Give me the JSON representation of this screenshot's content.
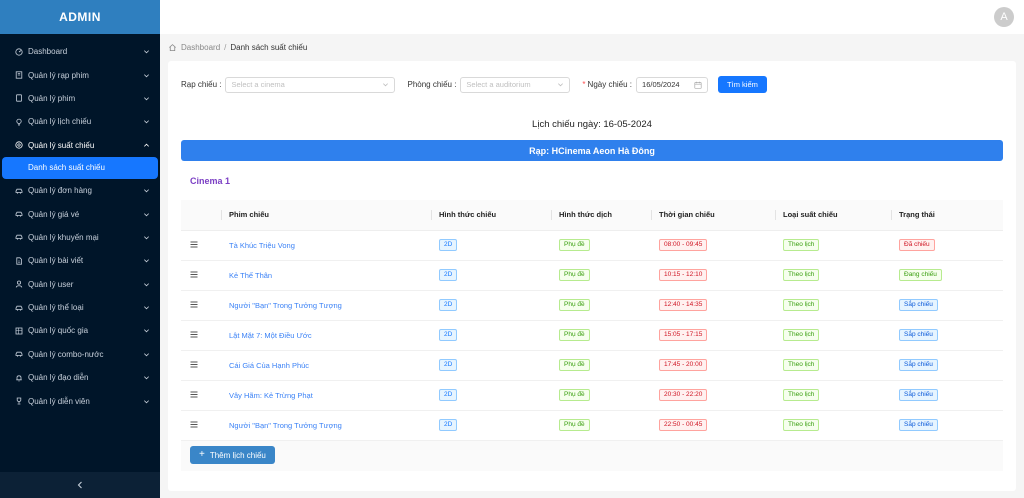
{
  "brand": "ADMIN",
  "sidebar": {
    "items": [
      {
        "label": "Dashboard",
        "icon": "dashboard-icon"
      },
      {
        "label": "Quản lý rạp phim",
        "icon": "building-icon"
      },
      {
        "label": "Quản lý phim",
        "icon": "film-icon"
      },
      {
        "label": "Quản lý lịch chiếu",
        "icon": "bulb-icon"
      },
      {
        "label": "Quản lý suất chiếu",
        "icon": "clock-icon",
        "open": true
      },
      {
        "label": "Quản lý đơn hàng",
        "icon": "car-icon"
      },
      {
        "label": "Quản lý giá vé",
        "icon": "car-icon"
      },
      {
        "label": "Quản lý khuyến mại",
        "icon": "car-icon"
      },
      {
        "label": "Quản lý bài viết",
        "icon": "document-icon"
      },
      {
        "label": "Quản lý user",
        "icon": "user-icon"
      },
      {
        "label": "Quản lý thể loại",
        "icon": "car-icon"
      },
      {
        "label": "Quản lý quốc gia",
        "icon": "flag-icon"
      },
      {
        "label": "Quản lý combo-nước",
        "icon": "car-icon"
      },
      {
        "label": "Quản lý đạo diễn",
        "icon": "bell-icon"
      },
      {
        "label": "Quản lý diễn viên",
        "icon": "trophy-icon"
      }
    ],
    "sub_active": "Danh sách suất chiếu"
  },
  "avatar": "A",
  "breadcrumb": {
    "home": "Dashboard",
    "sep": "/",
    "current": "Danh sách suất chiếu"
  },
  "filters": {
    "cinema_label": "Rạp chiếu",
    "cinema_placeholder": "Select a cinema",
    "room_label": "Phòng chiếu",
    "room_placeholder": "Select a auditorium",
    "date_label": "Ngày chiếu",
    "date_required": "*",
    "date_value": "16/05/2024",
    "search_button": "Tìm kiếm"
  },
  "schedule_title": "Lịch chiếu ngày: 16-05-2024",
  "cinema_name": "Rạp: HCinema Aeon Hà Đông",
  "room_name": "Cinema 1",
  "table": {
    "headers": [
      "Phim chiếu",
      "Hình thức chiếu",
      "Hình thức dịch",
      "Thời gian chiếu",
      "Loại suất chiếu",
      "Trạng thái"
    ],
    "rows": [
      {
        "film": "Tà Khúc Triệu Vong",
        "format": "2D",
        "translation": "Phụ đề",
        "time": "08:00 - 09:45",
        "type": "Theo lịch",
        "status": "Đã chiếu",
        "status_style": "red"
      },
      {
        "film": "Kẻ Thế Thân",
        "format": "2D",
        "translation": "Phụ đề",
        "time": "10:15 - 12:10",
        "type": "Theo lịch",
        "status": "Đang chiếu",
        "status_style": "green"
      },
      {
        "film": "Người \"Bạn\" Trong Tưởng Tượng",
        "format": "2D",
        "translation": "Phụ đề",
        "time": "12:40 - 14:35",
        "type": "Theo lịch",
        "status": "Sắp chiếu",
        "status_style": "lblue"
      },
      {
        "film": "Lật Mặt 7: Một Điều Ước",
        "format": "2D",
        "translation": "Phụ đề",
        "time": "15:05 - 17:15",
        "type": "Theo lịch",
        "status": "Sắp chiếu",
        "status_style": "lblue"
      },
      {
        "film": "Cái Giá Của Hạnh Phúc",
        "format": "2D",
        "translation": "Phụ đề",
        "time": "17:45 - 20:00",
        "type": "Theo lịch",
        "status": "Sắp chiếu",
        "status_style": "lblue"
      },
      {
        "film": "Vây Hãm: Kẻ Trừng Phạt",
        "format": "2D",
        "translation": "Phụ đề",
        "time": "20:30 - 22:20",
        "type": "Theo lịch",
        "status": "Sắp chiếu",
        "status_style": "lblue"
      },
      {
        "film": "Người \"Bạn\" Trong Tưởng Tượng",
        "format": "2D",
        "translation": "Phụ đề",
        "time": "22:50 - 00:45",
        "type": "Theo lịch",
        "status": "Sắp chiếu",
        "status_style": "lblue"
      }
    ]
  },
  "add_button": "Thêm lịch chiếu"
}
